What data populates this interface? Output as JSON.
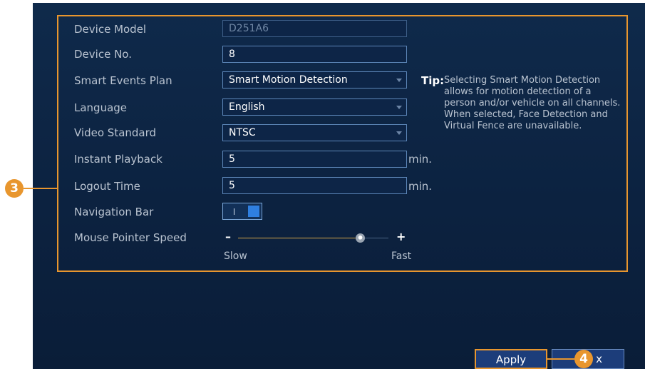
{
  "form": {
    "device_model": {
      "label": "Device Model",
      "value": "D251A6"
    },
    "device_no": {
      "label": "Device No.",
      "value": "8"
    },
    "smart_events_plan": {
      "label": "Smart Events Plan",
      "value": "Smart Motion Detection"
    },
    "language": {
      "label": "Language",
      "value": "English"
    },
    "video_standard": {
      "label": "Video Standard",
      "value": "NTSC"
    },
    "instant_playback": {
      "label": "Instant Playback",
      "value": "5",
      "unit": "min."
    },
    "logout_time": {
      "label": "Logout Time",
      "value": "5",
      "unit": "min."
    },
    "navigation_bar": {
      "label": "Navigation Bar",
      "enabled": true
    },
    "mouse_pointer_speed": {
      "label": "Mouse Pointer Speed",
      "minus": "–",
      "plus": "+",
      "slow_label": "Slow",
      "fast_label": "Fast",
      "level": 0.8
    }
  },
  "tip": {
    "heading": "Tip:",
    "text": "Selecting Smart Motion Detection allows for motion detection of a person and/or vehicle on all channels. When selected, Face Detection and Virtual Fence are unavailable."
  },
  "buttons": {
    "apply": "Apply",
    "exit_partial": "x"
  },
  "callouts": {
    "step3": "3",
    "step4": "4"
  },
  "colors": {
    "highlight": "#e8962e",
    "panel": "#0c2240",
    "toggle_on": "#2f7fe0"
  }
}
